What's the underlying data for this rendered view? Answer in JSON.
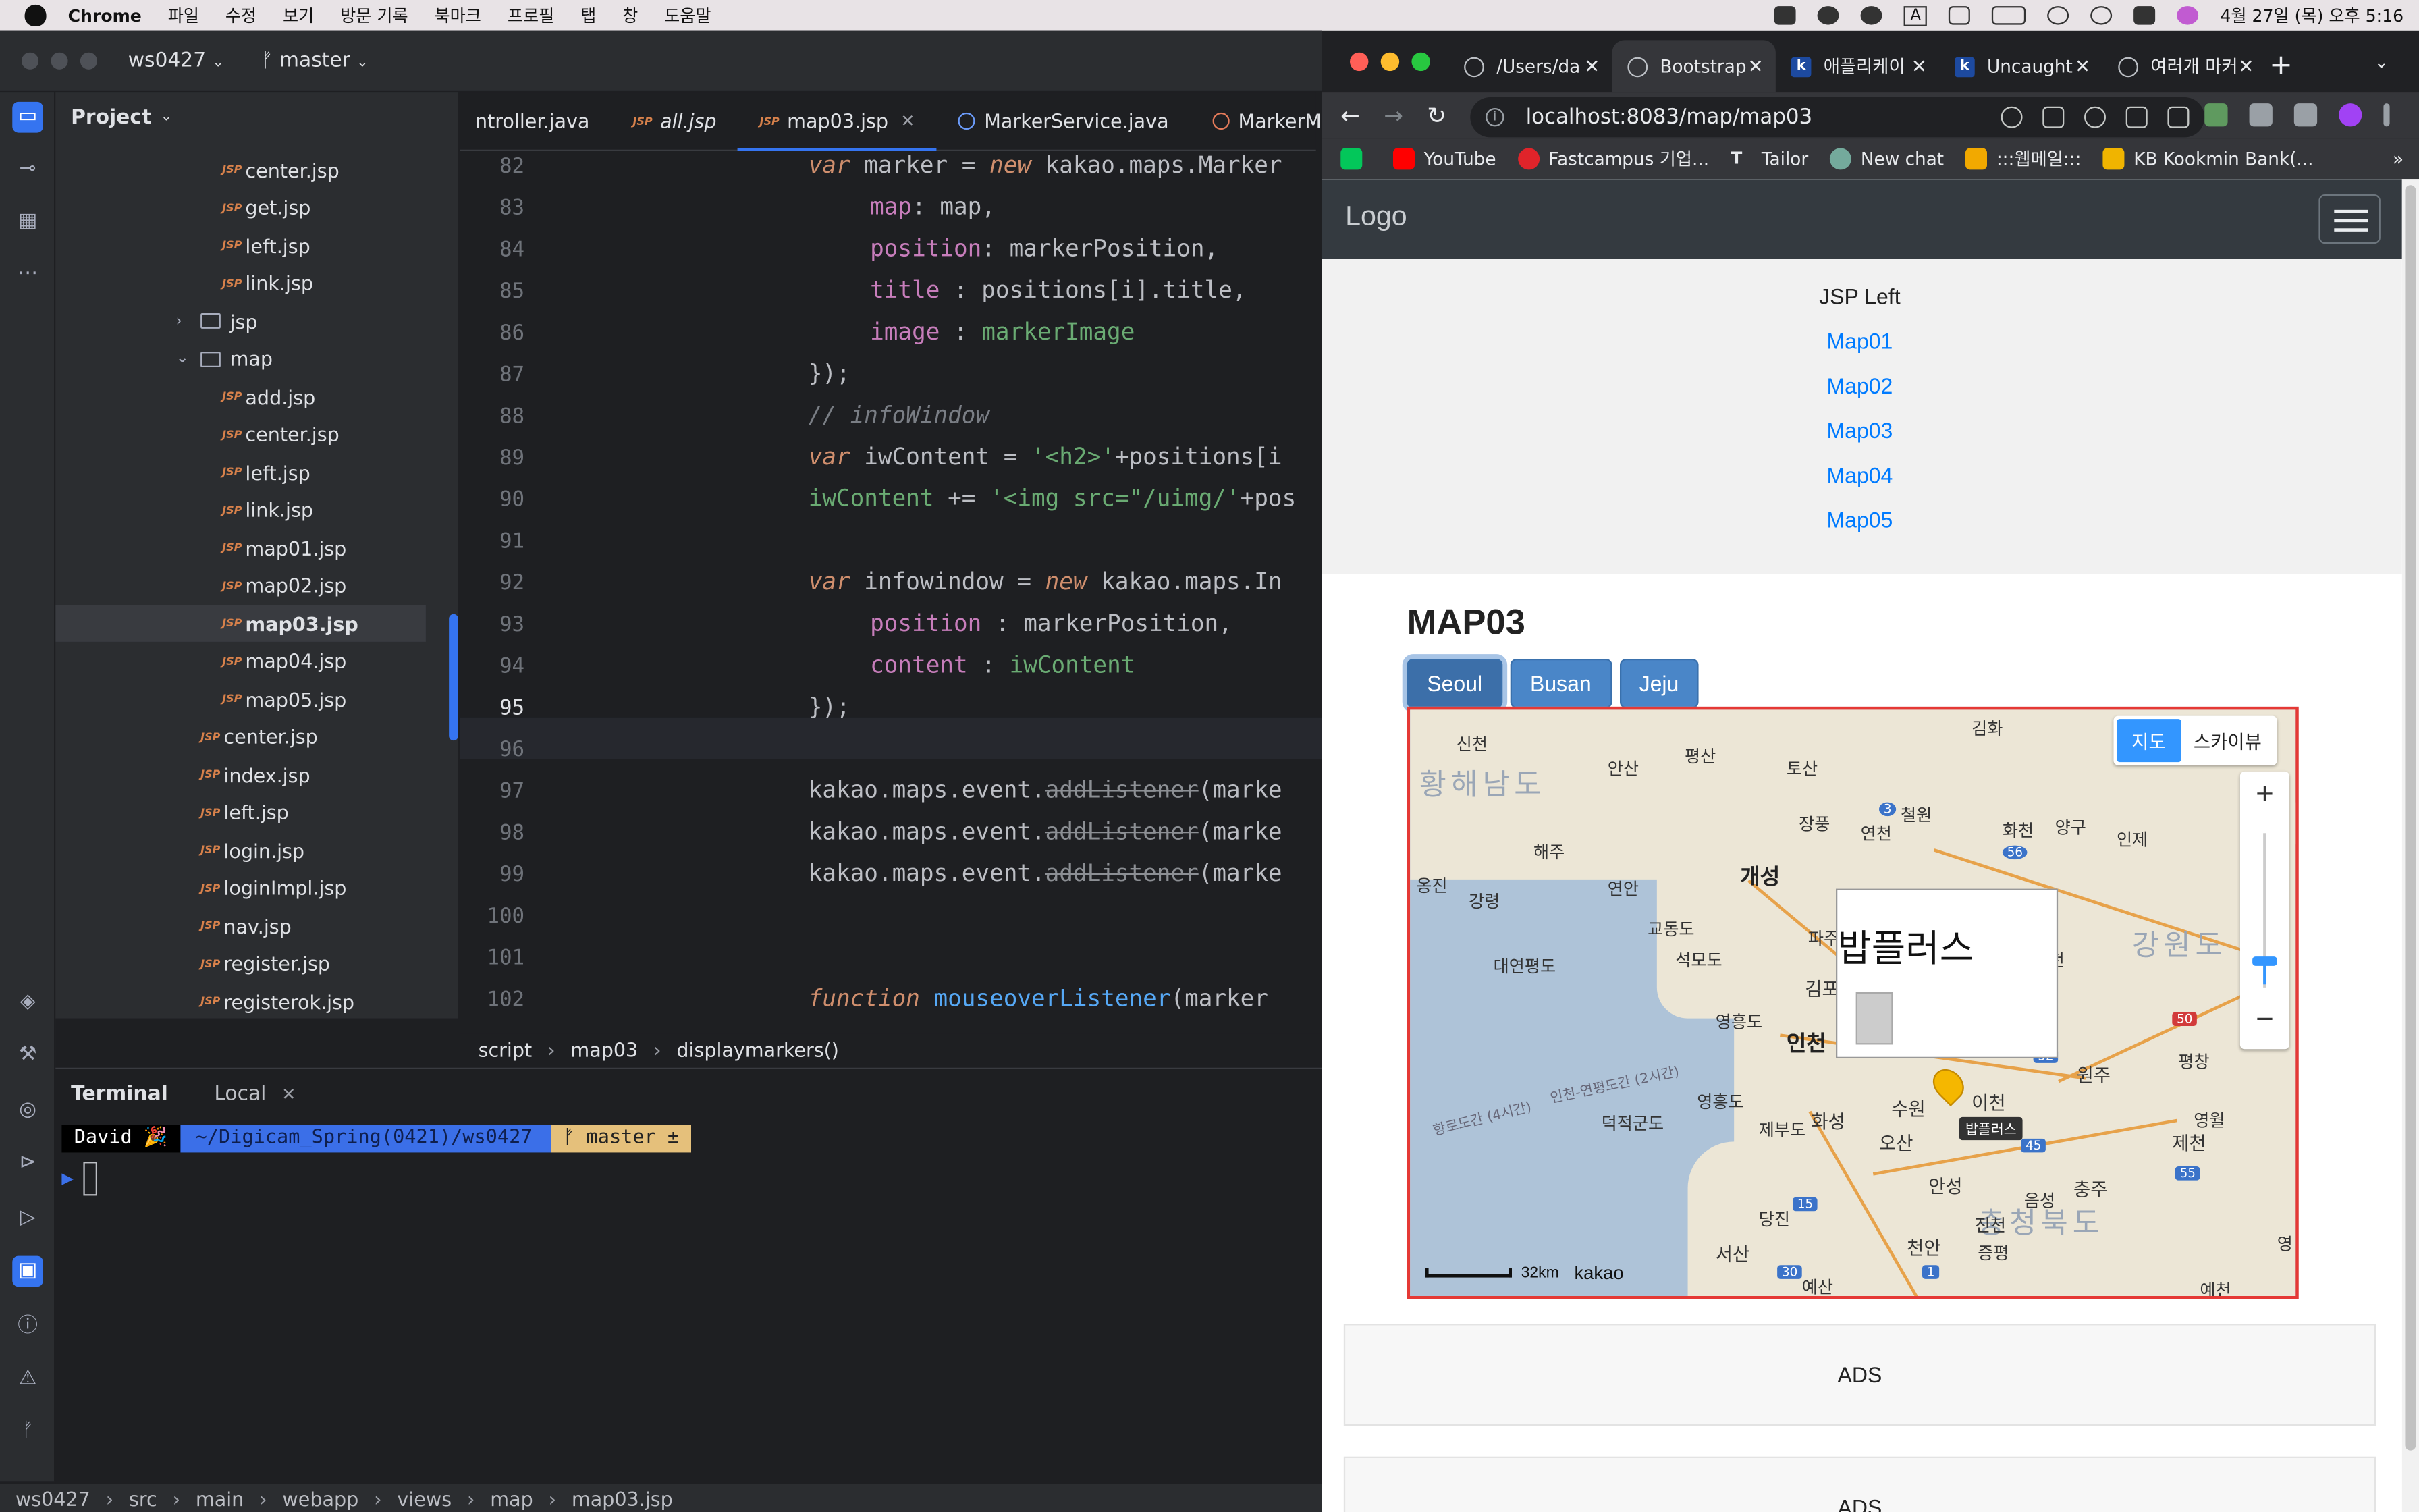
{
  "menubar": {
    "app": "Chrome",
    "items": [
      "파일",
      "수정",
      "보기",
      "방문 기록",
      "북마크",
      "프로필",
      "탭",
      "창",
      "도움말"
    ],
    "clock": "4월 27일 (목) 오후 5:16",
    "input_indicator": "A"
  },
  "ide": {
    "project_name": "ws0427",
    "branch": "master",
    "project_panel_title": "Project",
    "tree": [
      {
        "label": "center.jsp",
        "type": "jsp",
        "indent": 2
      },
      {
        "label": "get.jsp",
        "type": "jsp",
        "indent": 2
      },
      {
        "label": "left.jsp",
        "type": "jsp",
        "indent": 2
      },
      {
        "label": "link.jsp",
        "type": "jsp",
        "indent": 2
      },
      {
        "label": "jsp",
        "type": "folder-collapsed",
        "indent": 1
      },
      {
        "label": "map",
        "type": "folder-expanded",
        "indent": 1
      },
      {
        "label": "add.jsp",
        "type": "jsp",
        "indent": 2
      },
      {
        "label": "center.jsp",
        "type": "jsp",
        "indent": 2
      },
      {
        "label": "left.jsp",
        "type": "jsp",
        "indent": 2
      },
      {
        "label": "link.jsp",
        "type": "jsp",
        "indent": 2
      },
      {
        "label": "map01.jsp",
        "type": "jsp",
        "indent": 2
      },
      {
        "label": "map02.jsp",
        "type": "jsp",
        "indent": 2
      },
      {
        "label": "map03.jsp",
        "type": "jsp",
        "indent": 2,
        "selected": true
      },
      {
        "label": "map04.jsp",
        "type": "jsp",
        "indent": 2
      },
      {
        "label": "map05.jsp",
        "type": "jsp",
        "indent": 2
      },
      {
        "label": "center.jsp",
        "type": "jsp",
        "indent": 1
      },
      {
        "label": "index.jsp",
        "type": "jsp",
        "indent": 1
      },
      {
        "label": "left.jsp",
        "type": "jsp",
        "indent": 1
      },
      {
        "label": "login.jsp",
        "type": "jsp",
        "indent": 1
      },
      {
        "label": "loginImpl.jsp",
        "type": "jsp",
        "indent": 1
      },
      {
        "label": "nav.jsp",
        "type": "jsp",
        "indent": 1
      },
      {
        "label": "register.jsp",
        "type": "jsp",
        "indent": 1
      },
      {
        "label": "registerok.jsp",
        "type": "jsp",
        "indent": 1
      }
    ],
    "editor_tabs": [
      {
        "label": "ntroller.java",
        "icon": "none"
      },
      {
        "label": "all.jsp",
        "icon": "jsp"
      },
      {
        "label": "map03.jsp",
        "icon": "jsp",
        "active": true
      },
      {
        "label": "MarkerService.java",
        "icon": "java"
      },
      {
        "label": "MarkerMapper",
        "icon": "java-orange"
      }
    ],
    "line_numbers": [
      "82",
      "83",
      "84",
      "85",
      "86",
      "87",
      "88",
      "89",
      "90",
      "91",
      "92",
      "93",
      "94",
      "95",
      "96",
      "97",
      "98",
      "99",
      "100",
      "101",
      "102"
    ],
    "current_line": "95",
    "breadcrumb": [
      "script",
      "map03",
      "displaymarkers()"
    ],
    "terminal": {
      "title": "Terminal",
      "tab": "Local",
      "user": "David 🎉",
      "path": "~/Digicam_Spring(0421)/ws0427",
      "branch": "ᚠ master ±"
    },
    "status_path": [
      "ws0427",
      "src",
      "main",
      "webapp",
      "views",
      "map",
      "map03.jsp"
    ]
  },
  "chrome": {
    "tabs": [
      {
        "label": "/Users/da",
        "icon": "globe"
      },
      {
        "label": "Bootstrap",
        "icon": "globe",
        "active": true
      },
      {
        "label": "애플리케이",
        "icon": "k"
      },
      {
        "label": "Uncaught",
        "icon": "k"
      },
      {
        "label": "여러개 마커",
        "icon": "pin"
      }
    ],
    "url": "localhost:8083/map/map03",
    "bookmarks": [
      "YouTube",
      "Fastcampus 기업...",
      "Tailor",
      "New chat",
      ":::웹메일:::",
      "KB Kookmin Bank(..."
    ],
    "bookmark_colors": [
      "#ff0000",
      "#e0242a",
      "#111111",
      "#74aa9c",
      "#f2a900",
      "#f0b400"
    ]
  },
  "page": {
    "brand": "Logo",
    "left_title": "JSP Left",
    "left_links": [
      "Map01",
      "Map02",
      "Map03",
      "Map04",
      "Map05"
    ],
    "heading": "MAP03",
    "buttons": [
      "Seoul",
      "Busan",
      "Jeju"
    ],
    "map": {
      "type_on": "지도",
      "type_off": "스카이뷰",
      "zoom_in": "+",
      "zoom_out": "−",
      "infowindow_title": "밥플러스",
      "marker_title": "밥플러스",
      "scale": "32km",
      "provider": "kakao",
      "labels": {
        "hwanghae": "황해남도",
        "gangwon": "강원도",
        "chungbuk": "충청북도",
        "gaeseong": "개성",
        "incheon": "인천",
        "suwon": "수원",
        "osan": "오산",
        "icheon": "이천",
        "wonju": "원주",
        "jecheon": "제천",
        "chungju": "충주",
        "anseong": "안성",
        "cheonan": "천안",
        "dangjin": "당진",
        "seosan": "서산",
        "hwaseong": "화성",
        "gimpo": "김포",
        "paju": "파주",
        "haeju": "해주",
        "ongjin": "옹진",
        "gangryeong": "강령",
        "yeonan": "연안",
        "sincheon": "신천",
        "ansan_n": "안산",
        "pyeongsan": "평산",
        "tosan": "토산",
        "gimhwa": "김화",
        "cheorwon": "철원",
        "yeoncheon": "연천",
        "jangpung": "장풍",
        "hwacheon": "화천",
        "yanggu": "양구",
        "inje": "인제",
        "hongcheon": "홍천",
        "pyeongchang": "평창",
        "yeongwol": "영월",
        "yeonpyeong": "대연평도",
        "gyodong": "교동도",
        "seongmo": "석모도",
        "yeongjong": "영흥도",
        "deokjeok": "덕적군도",
        "jebu": "제부도",
        "jincheon": "진천",
        "eumseong": "음성",
        "jeungpyeong": "증평",
        "yesan": "예산",
        "yecheon": "예천",
        "yeong": "영",
        "sea_route": "인천-연평도간 (2시간)",
        "sea_route2": "항로도간 (4시간)",
        "road_3": "3",
        "road_56": "56",
        "road_50": "50",
        "road_52": "52",
        "road_45": "45",
        "road_55": "55",
        "road_15": "15",
        "road_30": "30",
        "road_1": "1"
      }
    },
    "ads": [
      "ADS",
      "ADS"
    ]
  }
}
